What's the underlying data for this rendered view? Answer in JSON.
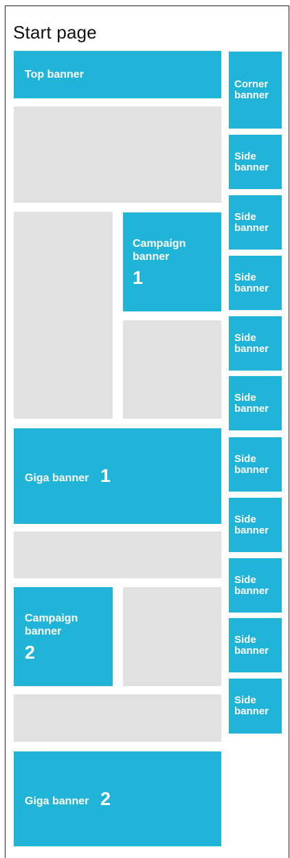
{
  "page": {
    "title": "Start page"
  },
  "colors": {
    "banner": "#1fb4d8",
    "placeholder": "#e1e1e1",
    "border": "#222222",
    "text": "#ffffff"
  },
  "main": {
    "top_banner": "Top banner",
    "campaign_banner_1": {
      "word1": "Campaign",
      "word2": "banner",
      "number": "1"
    },
    "giga_banner_1": {
      "label": "Giga banner",
      "number": "1"
    },
    "campaign_banner_2": {
      "word1": "Campaign",
      "word2": "banner",
      "number": "2"
    },
    "giga_banner_2": {
      "label": "Giga banner",
      "number": "2"
    }
  },
  "sidebar": {
    "corner_banner": {
      "word1": "Corner",
      "word2": "banner"
    },
    "side_banners": [
      {
        "word1": "Side",
        "word2": "banner"
      },
      {
        "word1": "Side",
        "word2": "banner"
      },
      {
        "word1": "Side",
        "word2": "banner"
      },
      {
        "word1": "Side",
        "word2": "banner"
      },
      {
        "word1": "Side",
        "word2": "banner"
      },
      {
        "word1": "Side",
        "word2": "banner"
      },
      {
        "word1": "Side",
        "word2": "banner"
      },
      {
        "word1": "Side",
        "word2": "banner"
      },
      {
        "word1": "Side",
        "word2": "banner"
      },
      {
        "word1": "Side",
        "word2": "banner"
      }
    ]
  }
}
